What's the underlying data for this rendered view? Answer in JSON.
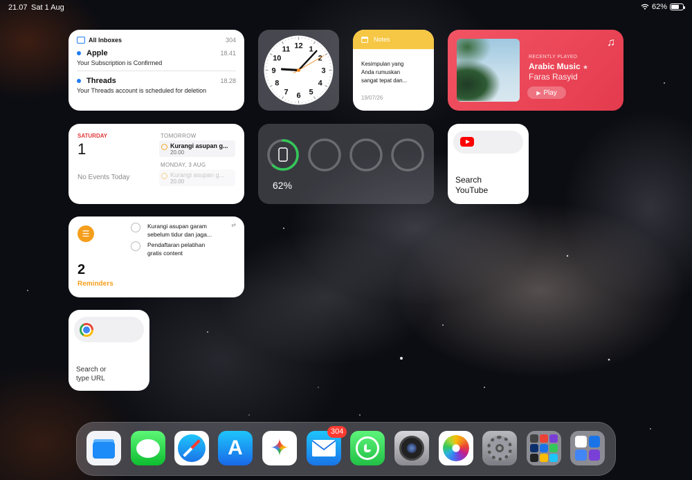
{
  "status_bar": {
    "time": "21.07",
    "date": "Sat 1 Aug",
    "battery": "62%",
    "battery_level": 0.62
  },
  "mail_widget": {
    "title": "All Inboxes",
    "count": "304",
    "messages": [
      {
        "sender": "Apple",
        "time": "18.41",
        "subject": "Your Subscription is Confirmed"
      },
      {
        "sender": "Threads",
        "time": "18.28",
        "subject": "Your Threads account is scheduled for deletion"
      }
    ]
  },
  "clock_widget": {
    "numbers": [
      "12",
      "1",
      "2",
      "3",
      "4",
      "5",
      "6",
      "7",
      "8",
      "9",
      "10",
      "11"
    ],
    "time": "21.07"
  },
  "notes_widget": {
    "title": "Notes",
    "lines": [
      "Kesimpulan yang",
      "Anda rumuskan",
      "sangat tepat dan..."
    ],
    "date": "19/07/26"
  },
  "music_widget": {
    "label": "RECENTLY PLAYED",
    "song": "Arabic Music",
    "artist": "Faras Rasyid",
    "play_label": "Play",
    "accent": "#ee4658"
  },
  "calendar_widget": {
    "day": "SATURDAY",
    "date": "1",
    "no_events": "No Events Today",
    "sections": [
      {
        "heading": "TOMORROW",
        "event": "Kurangi asupan g...",
        "time": "20.00"
      },
      {
        "heading": "MONDAY, 3 AUG",
        "event": "Kurangi asupan g...",
        "time": "20.00"
      }
    ]
  },
  "battery_widget": {
    "percent": "62%",
    "level": 0.62,
    "accent": "#34c759"
  },
  "youtube_widget": {
    "label_line1": "Search",
    "label_line2": "YouTube"
  },
  "reminders_widget": {
    "count": "2",
    "label": "Reminders",
    "items": [
      {
        "line1": "Kurangi asupan garam",
        "line2": "sebelum tidur dan jaga..."
      },
      {
        "line1": "Pendaftaran pelatihan",
        "line2": "gratis content"
      }
    ]
  },
  "chrome_widget": {
    "label_line1": "Search or",
    "label_line2": "type URL"
  },
  "dock": {
    "apps": [
      {
        "icon": "files-icon"
      },
      {
        "icon": "messages-icon"
      },
      {
        "icon": "safari-icon"
      },
      {
        "icon": "app-store-icon"
      },
      {
        "icon": "gemini-icon"
      },
      {
        "icon": "mail-icon"
      },
      {
        "icon": "whatsapp-icon"
      },
      {
        "icon": "camera-icon"
      },
      {
        "icon": "photos-icon"
      },
      {
        "icon": "settings-icon"
      },
      {
        "icon": "app-folder-icon"
      },
      {
        "icon": "app-library-icon"
      }
    ],
    "mail_badge": "304"
  }
}
